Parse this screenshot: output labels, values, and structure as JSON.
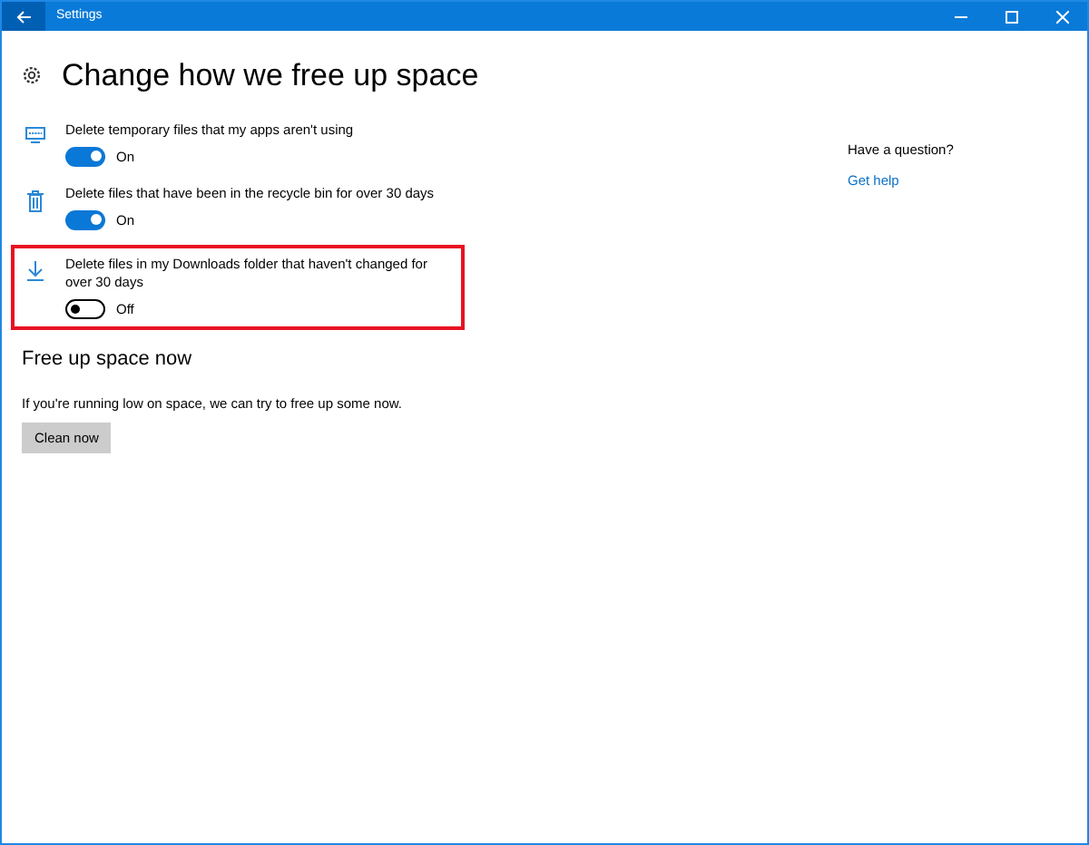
{
  "window": {
    "title": "Settings"
  },
  "page": {
    "title": "Change how we free up space"
  },
  "options": [
    {
      "label": "Delete temporary files that my apps aren't using",
      "on": true,
      "state_text": "On",
      "highlighted": false
    },
    {
      "label": "Delete files that have been in the recycle bin for over 30 days",
      "on": true,
      "state_text": "On",
      "highlighted": false
    },
    {
      "label": "Delete files in my Downloads folder that haven't changed for over 30 days",
      "on": false,
      "state_text": "Off",
      "highlighted": true
    }
  ],
  "free_up_now": {
    "heading": "Free up space now",
    "description": "If you're running low on space, we can try to free up some now.",
    "button": "Clean now"
  },
  "help": {
    "question": "Have a question?",
    "link": "Get help"
  }
}
